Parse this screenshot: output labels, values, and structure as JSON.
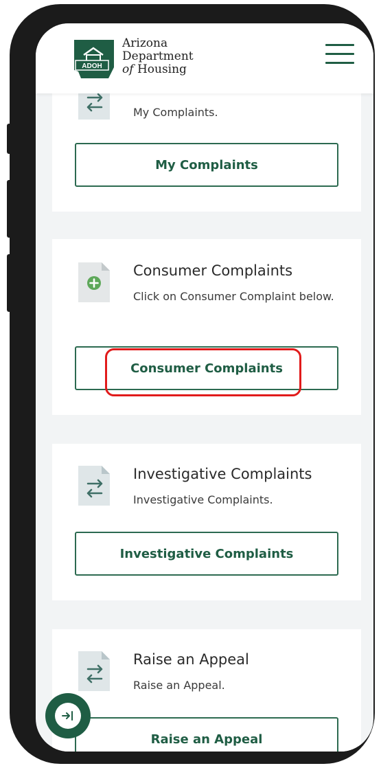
{
  "header": {
    "logo_badge": "ADOH",
    "logo_line1": "Arizona",
    "logo_line2": "Department",
    "logo_of": "of",
    "logo_line3": "Housing",
    "menu_icon": "hamburger-menu-icon"
  },
  "cards": [
    {
      "title": "",
      "description": "My Complaints.",
      "button_label": "My Complaints",
      "icon": "transfer-arrows-icon"
    },
    {
      "title": "Consumer Complaints",
      "description": "Click on Consumer Complaint below.",
      "button_label": "Consumer Complaints",
      "icon": "document-plus-icon"
    },
    {
      "title": "Investigative Complaints",
      "description": "Investigative Complaints.",
      "button_label": "Investigative Complaints",
      "icon": "transfer-arrows-icon"
    },
    {
      "title": "Raise an Appeal",
      "description": "Raise an Appeal.",
      "button_label": "Raise an Appeal",
      "icon": "transfer-arrows-icon"
    }
  ],
  "fab_icon": "expand-arrow-icon",
  "colors": {
    "brand_green": "#1f5d44",
    "highlight_red": "#e11b1b",
    "page_bg": "#f2f4f5"
  }
}
